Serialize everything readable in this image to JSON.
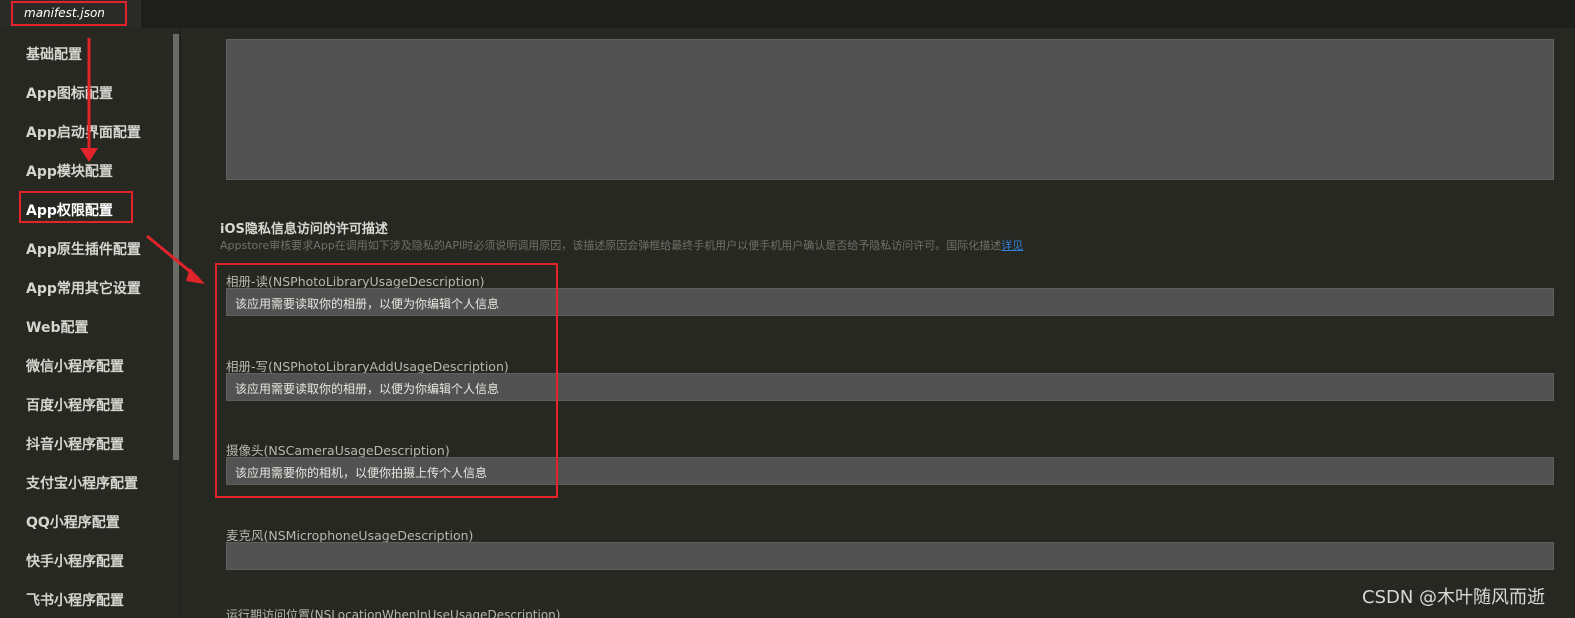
{
  "tab": {
    "label": "manifest.json"
  },
  "sidebar": {
    "items": [
      {
        "label": "基础配置"
      },
      {
        "label": "App图标配置"
      },
      {
        "label": "App启动界面配置"
      },
      {
        "label": "App模块配置"
      },
      {
        "label": "App权限配置"
      },
      {
        "label": "App原生插件配置"
      },
      {
        "label": "App常用其它设置"
      },
      {
        "label": "Web配置"
      },
      {
        "label": "微信小程序配置"
      },
      {
        "label": "百度小程序配置"
      },
      {
        "label": "抖音小程序配置"
      },
      {
        "label": "支付宝小程序配置"
      },
      {
        "label": "QQ小程序配置"
      },
      {
        "label": "快手小程序配置"
      },
      {
        "label": "飞书小程序配置"
      }
    ],
    "active_index": 4
  },
  "section": {
    "title": "iOS隐私信息访问的许可描述",
    "description": "Appstore审核要求App在调用如下涉及隐私的API时必须说明调用原因，该描述原因会弹框给最终手机用户以便手机用户确认是否给予隐私访问许可。国际化描述",
    "link_label": "详见"
  },
  "fields": [
    {
      "label": "相册-读(NSPhotoLibraryUsageDescription)",
      "value": "该应用需要读取你的相册，以便为你编辑个人信息"
    },
    {
      "label": "相册-写(NSPhotoLibraryAddUsageDescription)",
      "value": "该应用需要读取你的相册，以便为你编辑个人信息"
    },
    {
      "label": "摄像头(NSCameraUsageDescription)",
      "value": "该应用需要你的相机，以便你拍摄上传个人信息"
    },
    {
      "label": "麦克风(NSMicrophoneUsageDescription)",
      "value": ""
    }
  ],
  "cutoff_label": "运行期访问位置(NSLocationWhenInUseUsageDescription)",
  "watermark": "CSDN @木叶随风而逝",
  "colors": {
    "annotation": "#e0242a",
    "link": "#2f7fd6",
    "background": "#272822"
  }
}
